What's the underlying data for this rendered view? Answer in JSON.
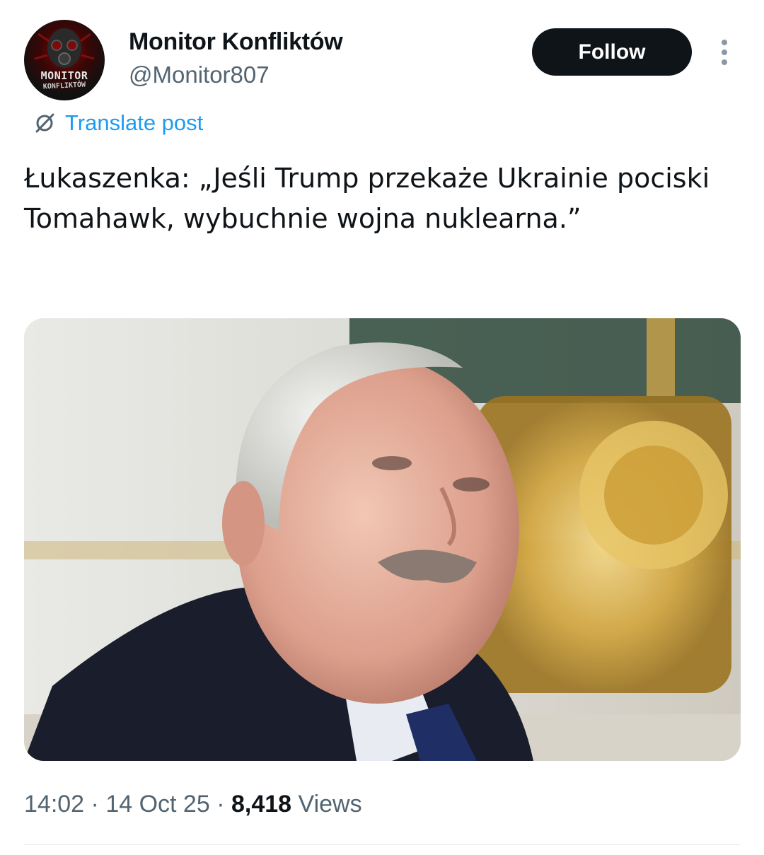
{
  "author": {
    "display_name": "Monitor Konfliktów",
    "handle": "@Monitor807",
    "avatar": {
      "icon": "gas-mask-logo",
      "line1": "MONITOR",
      "line2": "KONFLIKTÓW"
    }
  },
  "follow_label": "Follow",
  "more_icon": "more-vertical-icon",
  "translate_label": "Translate post",
  "translate_icon": "globe-slash-icon",
  "post_text": "Łukaszenka: „Jeśli Trump przekaże Ukrainie pociski Tomahawk, wybuchnie wojna nuklearna.”",
  "meta": {
    "time": "14:02",
    "separator": "·",
    "date": "14 Oct 25",
    "views_count": "8,418",
    "views_label": "Views"
  },
  "colors": {
    "accent": "#1d9bf0",
    "follow_bg": "#0f1419",
    "secondary_text": "#536471"
  }
}
